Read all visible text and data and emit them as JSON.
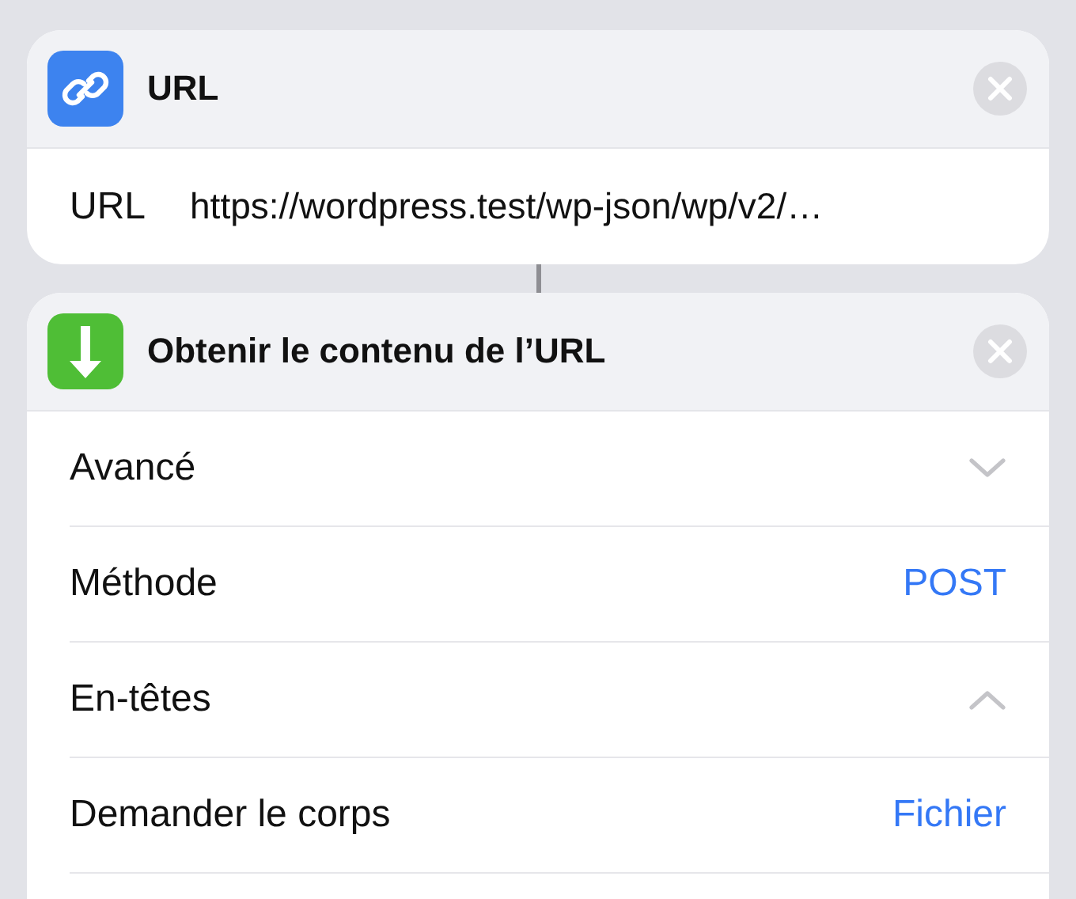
{
  "actions": [
    {
      "kind": "url",
      "title": "URL",
      "fields": [
        {
          "kind": "text",
          "label": "URL",
          "value": "https://wordpress.test/wp-json/wp/v2/…"
        }
      ]
    },
    {
      "kind": "download",
      "title": "Obtenir le contenu de l’URL",
      "fields": [
        {
          "kind": "disclosure",
          "label": "Avancé",
          "expanded": false
        },
        {
          "kind": "value",
          "label": "Méthode",
          "value": "POST"
        },
        {
          "kind": "disclosure",
          "label": "En-têtes",
          "expanded": true
        },
        {
          "kind": "value",
          "label": "Demander le corps",
          "value": "Fichier"
        }
      ]
    }
  ]
}
